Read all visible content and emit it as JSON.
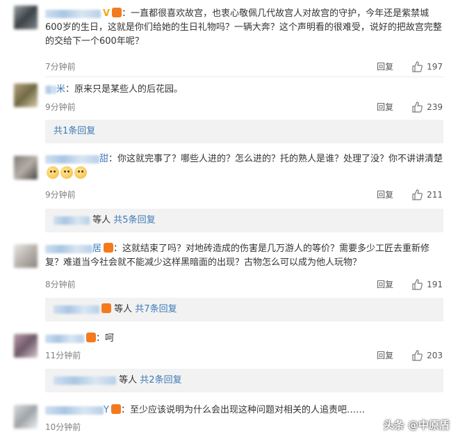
{
  "comments": [
    {
      "text": "：一直都很喜欢故宫，也衷心敬佩几代故宫人对故宫的守护，今年还是紫禁城600岁的生日，这就是你们给她的生日礼物吗？一辆大奔？这个声明看的很难受，说好的把故宫完整的交给下一个600年呢？",
      "time": "7分钟前",
      "reply": "回复",
      "likes": "197"
    },
    {
      "name_tail": "米",
      "text": "：原来只是某些人的后花园。",
      "time": "9分钟前",
      "reply": "回复",
      "likes": "239",
      "sub_link": "共1条回复"
    },
    {
      "name_tail": "甜",
      "text": "：你这就完事了？哪些人进的？怎么进的？托的熟人是谁？处理了没？你不讲讲清楚",
      "time": "9分钟前",
      "reply": "回复",
      "likes": "211",
      "sub_prefix": "等人",
      "sub_link": "共5条回复"
    },
    {
      "name_tail": "居",
      "text": "：这就结束了吗？对地砖造成的伤害是几万游人的等价？需要多少工匠去重新修复？难道当今社会就不能减少这样黑暗面的出现？古物怎么可以成为他人玩物？",
      "time": "8分钟前",
      "reply": "回复",
      "likes": "191",
      "sub_prefix": "等人",
      "sub_link": "共7条回复"
    },
    {
      "text": "：呵",
      "time": "11分钟前",
      "reply": "回复",
      "likes": "203",
      "sub_prefix": "等人",
      "sub_link": "共2条回复"
    },
    {
      "name_tail": "Y",
      "text": "：至少应该说明为什么会出现这种问题对相关的人追责吧……",
      "time": "10分钟前"
    }
  ],
  "watermark": "头条 @中原盾",
  "colors": {
    "link": "#3d7ab8",
    "meta": "#808080",
    "subbox_bg": "#f2f2f2"
  },
  "icons": [
    "thumbs-up-icon",
    "vip-badge-icon",
    "emoji-surprised-icon"
  ]
}
